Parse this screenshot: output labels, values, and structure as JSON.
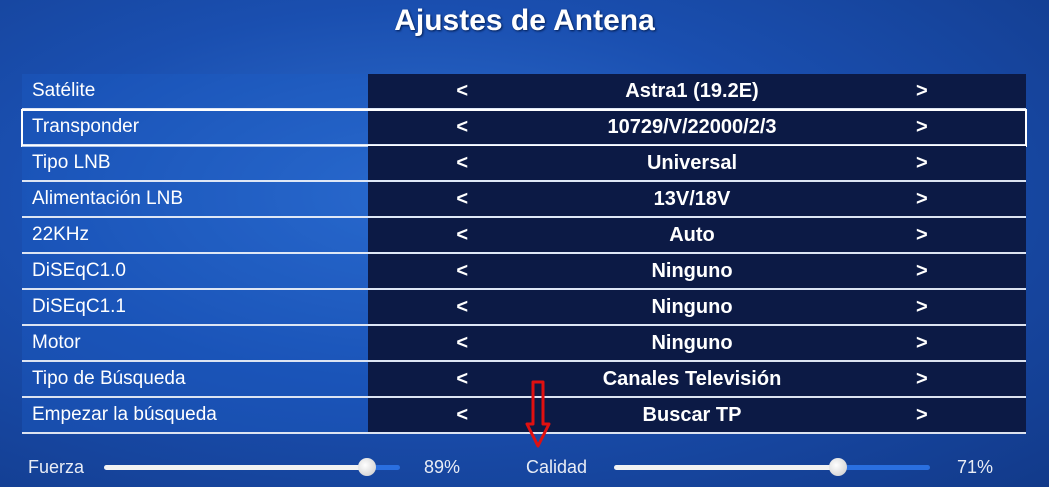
{
  "title": "Ajustes de Antena",
  "menu": [
    {
      "label": "Satélite",
      "value": "Astra1 (19.2E)",
      "left": "<",
      "right": ">"
    },
    {
      "label": "Transponder",
      "value": "10729/V/22000/2/3",
      "left": "<",
      "right": ">"
    },
    {
      "label": "Tipo LNB",
      "value": "Universal",
      "left": "<",
      "right": ">"
    },
    {
      "label": "Alimentación LNB",
      "value": "13V/18V",
      "left": "<",
      "right": ">"
    },
    {
      "label": "22KHz",
      "value": "Auto",
      "left": "<",
      "right": ">"
    },
    {
      "label": "DiSEqC1.0",
      "value": "Ninguno",
      "left": "<",
      "right": ">"
    },
    {
      "label": "DiSEqC1.1",
      "value": "Ninguno",
      "left": "<",
      "right": ">"
    },
    {
      "label": "Motor",
      "value": "Ninguno",
      "left": "<",
      "right": ">"
    },
    {
      "label": "Tipo de Búsqueda",
      "value": "Canales Televisión",
      "left": "<",
      "right": ">"
    },
    {
      "label": "Empezar la búsqueda",
      "value": "Buscar TP",
      "left": "<",
      "right": ">"
    }
  ],
  "signal": {
    "fuerza_label": "Fuerza",
    "fuerza_percent": "89%",
    "fuerza_value": 0.89,
    "calidad_label": "Calidad",
    "calidad_percent": "71%",
    "calidad_value": 0.71
  },
  "colors": {
    "accent_arrow": "#e01010",
    "bar_track": "#2a6fe0"
  }
}
